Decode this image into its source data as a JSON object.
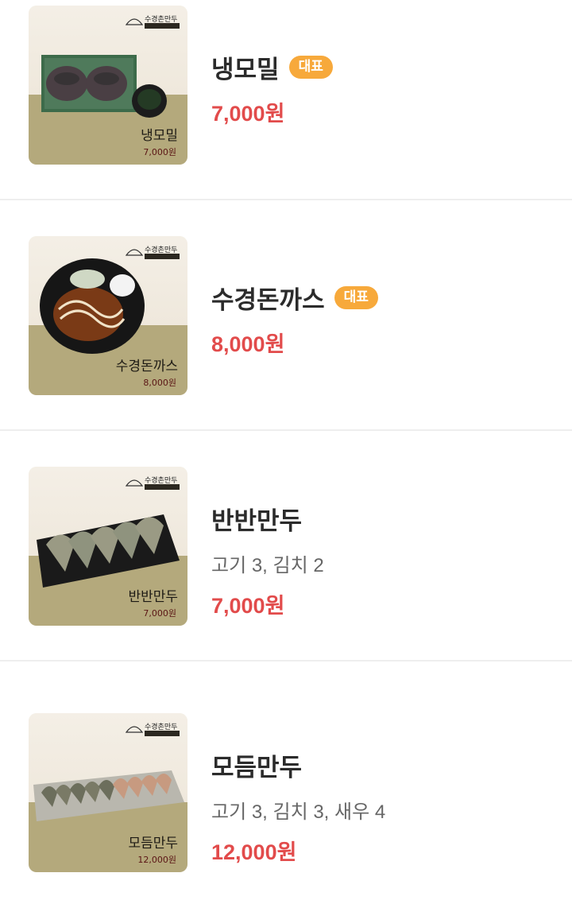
{
  "menu": [
    {
      "name": "냉모밀",
      "badge": "대표",
      "description": "",
      "price": "7,000원",
      "image_caption_name": "냉모밀",
      "image_caption_price": "7,000원",
      "image_brand": "수경촌만두"
    },
    {
      "name": "수경돈까스",
      "badge": "대표",
      "description": "",
      "price": "8,000원",
      "image_caption_name": "수경돈까스",
      "image_caption_price": "8,000원",
      "image_brand": "수경촌만두"
    },
    {
      "name": "반반만두",
      "badge": "",
      "description": "고기 3, 김치 2",
      "price": "7,000원",
      "image_caption_name": "반반만두",
      "image_caption_price": "7,000원",
      "image_brand": "수경촌만두"
    },
    {
      "name": "모듬만두",
      "badge": "",
      "description": "고기 3, 김치 3, 새우 4",
      "price": "12,000원",
      "image_caption_name": "모듬만두",
      "image_caption_price": "12,000원",
      "image_brand": "수경촌만두"
    }
  ],
  "colors": {
    "badge_bg": "#f7a93b",
    "price": "#e24b4b",
    "divider": "#eeeeee"
  }
}
